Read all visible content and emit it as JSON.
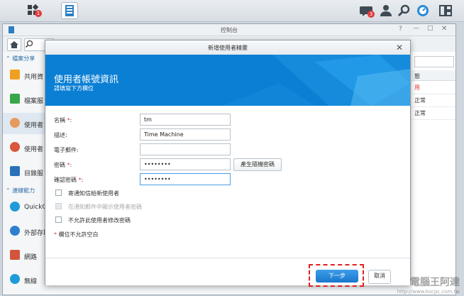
{
  "taskbar": {
    "apps_badge": "1",
    "notify_badge": "3"
  },
  "control_panel": {
    "title": "控制台",
    "sidebar": {
      "section1": "檔案分享",
      "items1": [
        "共用資",
        "檔案服",
        "使用者",
        "使用者",
        "目錄服"
      ],
      "section2": "連線能力",
      "items2": [
        "QuickC",
        "外部存取",
        "網路",
        "無線"
      ]
    },
    "right_col": {
      "header": "態",
      "rows": [
        "用",
        "正常",
        "正常"
      ]
    }
  },
  "wizard": {
    "title": "新增使用者精靈",
    "heading": "使用者帳號資訊",
    "subheading": "請填寫下方欄位",
    "fields": {
      "name_label": "名稱",
      "name_value": "tm",
      "desc_label": "描述:",
      "desc_value": "Time Machine",
      "email_label": "電子郵件:",
      "email_value": "",
      "password_label": "密碼",
      "password_value": "••••••••",
      "confirm_label": "確認密碼",
      "confirm_value": "••••••••"
    },
    "generate_password": "產生隨機密碼",
    "checkboxes": [
      "寄通知信給新使用者",
      "在通知郵件中顯示使用者密碼",
      "不允許此使用者修改密碼"
    ],
    "required_note": "欄位不允許空白",
    "next": "下一步",
    "cancel": "取消"
  },
  "watermark": {
    "brand": "電腦王阿達",
    "url": "http://www.kocpc.com.tw"
  },
  "colors": {
    "accent": "#0a7fd4",
    "required": "#e23b3b",
    "highlight_dash": "#e02020"
  }
}
